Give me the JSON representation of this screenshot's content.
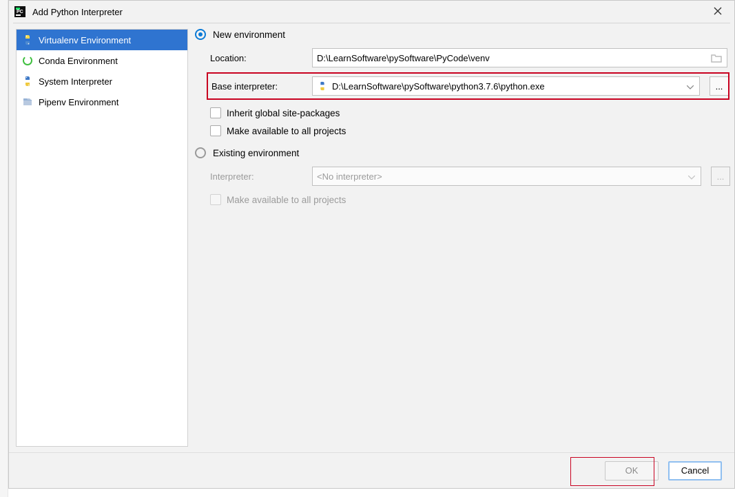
{
  "window": {
    "title": "Add Python Interpreter"
  },
  "sidebar": {
    "items": [
      {
        "label": "Virtualenv Environment"
      },
      {
        "label": "Conda Environment"
      },
      {
        "label": "System Interpreter"
      },
      {
        "label": "Pipenv Environment"
      }
    ]
  },
  "newEnv": {
    "radio_label": "New environment",
    "location_label": "Location:",
    "location_value": "D:\\LearnSoftware\\pySoftware\\PyCode\\venv",
    "base_label": "Base interpreter:",
    "base_value": "D:\\LearnSoftware\\pySoftware\\python3.7.6\\python.exe",
    "inherit_label": "Inherit global site-packages",
    "make_avail_label": "Make available to all projects"
  },
  "existingEnv": {
    "radio_label": "Existing environment",
    "interpreter_label": "Interpreter:",
    "interpreter_value": "<No interpreter>",
    "make_avail_label": "Make available to all projects"
  },
  "footer": {
    "ok_label": "OK",
    "cancel_label": "Cancel"
  },
  "icons": {
    "browse": "..."
  }
}
